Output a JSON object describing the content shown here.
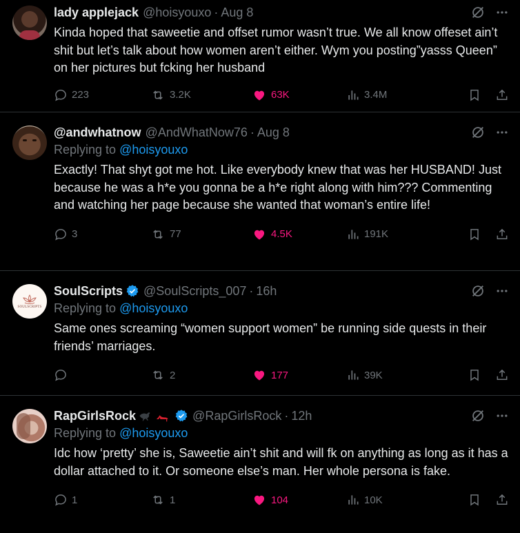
{
  "colors": {
    "background": "#000000",
    "text": "#e7e9ea",
    "muted": "#71767b",
    "link": "#1d9bf0",
    "like": "#f91880",
    "verified": "#1d9bf0",
    "divider": "#2f3336"
  },
  "tweets": [
    {
      "name": "lady applejack",
      "handle": "@hoisyouxo",
      "time": "Aug 8",
      "verified": false,
      "reply_prefix": "",
      "reply_handle": "",
      "text": "Kinda hoped that saweetie and offset rumor wasn’t true. We all know offeset ain’t shit but let’s talk about how women aren’t either. Wym you posting”yasss Queen” on her pictures but fcking her husband",
      "replies": "223",
      "retweets": "3.2K",
      "likes": "63K",
      "views": "3.4M",
      "avatar_icon": "person-avatar"
    },
    {
      "name": "@andwhatnow",
      "handle": "@AndWhatNow76",
      "time": "Aug 8",
      "verified": false,
      "reply_prefix": "Replying to ",
      "reply_handle": "@hoisyouxo",
      "text": "Exactly! That shyt got me hot. Like everybody knew that was her HUSBAND! Just because he was a h*e you gonna be a h*e right along with him??? Commenting and watching her page because she wanted that woman’s entire life!",
      "replies": "3",
      "retweets": "77",
      "likes": "4.5K",
      "views": "191K",
      "avatar_icon": "person-avatar"
    },
    {
      "name": "SoulScripts",
      "handle": "@SoulScripts_007",
      "time": "16h",
      "verified": true,
      "reply_prefix": "Replying to ",
      "reply_handle": "@hoisyouxo",
      "text": "Same ones screaming “women support women” be running side quests in their friends’ marriages.",
      "replies": "",
      "retweets": "2",
      "likes": "177",
      "views": "39K",
      "avatar_text": "SOULSCRIPTS"
    },
    {
      "name": "RapGirlsRock",
      "name_emojis": [
        "crow-emoji",
        "high-heel-emoji"
      ],
      "handle": "@RapGirlsRock",
      "time": "12h",
      "verified": true,
      "reply_prefix": "Replying to ",
      "reply_handle": "@hoisyouxo",
      "text": "Idc how ‘pretty’ she is, Saweetie ain’t shit and will fk on anything as long as it has a dollar attached to it. Or someone else’s man. Her whole persona is fake.",
      "replies": "1",
      "retweets": "1",
      "likes": "104",
      "views": "10K",
      "avatar_icon": "person-avatar"
    }
  ]
}
